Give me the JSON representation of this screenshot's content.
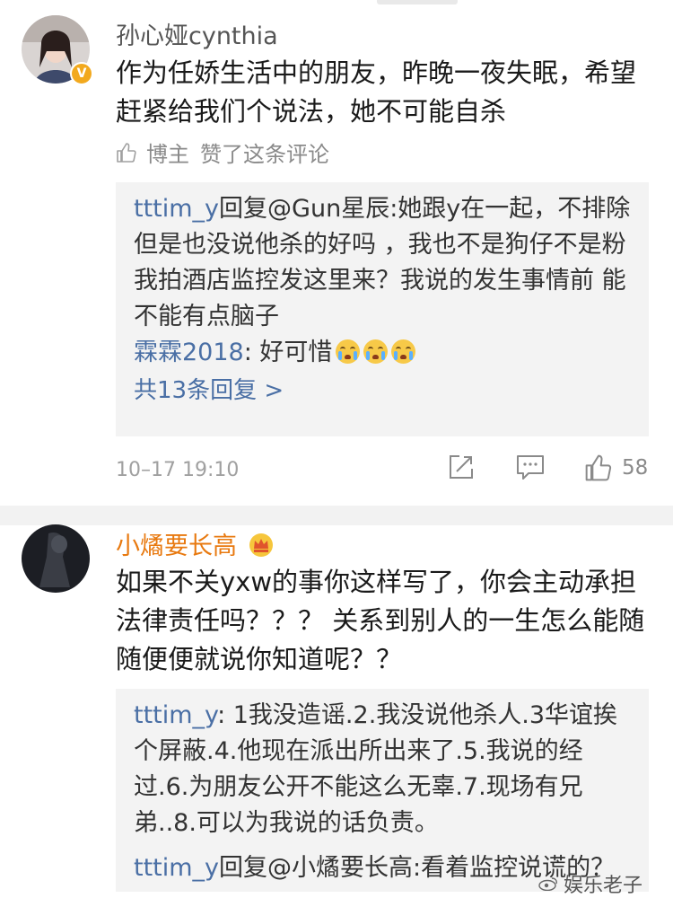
{
  "comments": [
    {
      "username": "孙心娅cynthia",
      "verified_badge": "V",
      "text": "作为任娇生活中的朋友，昨晚一夜失眠，希望赶紧给我们个说法，她不可能自杀",
      "liked_by_author": {
        "label": "博主",
        "text": "赞了这条评论"
      },
      "replies": [
        {
          "user": "tttim_y",
          "text": "回复@Gun星辰:她跟y在一起，不排除但是也没说他杀的好吗 ，我也不是狗仔不是粉 我拍酒店监控发这里来？我说的发生事情前 能不能有点脑子"
        },
        {
          "user": "霖霖2018",
          "text": ": 好可惜"
        }
      ],
      "more_replies": "共13条回复 >",
      "timestamp": "10–17 19:10",
      "like_count": "58"
    },
    {
      "username": "小燏要长高",
      "text": "如果不关yxw的事你这样写了，你会主动承担法律责任吗？？？ 关系到别人的一生怎么能随随便便就说你知道呢？？",
      "replies": [
        {
          "user": "tttim_y",
          "text": ": 1我没造谣.2.我没说他杀人.3华谊挨个屏蔽.4.他现在派出所出来了.5.我说的经过.6.为朋友公开不能这么无辜.7.现场有兄弟..8.可以为我说的话负责。"
        },
        {
          "user": "tttim_y",
          "text": "回复@小燏要长高:看着监控说谎的？"
        }
      ]
    }
  ],
  "watermark": "娱乐老子",
  "colors": {
    "link": "#4a6fa5",
    "vip": "#e8790f",
    "badge": "#f2a91e"
  }
}
